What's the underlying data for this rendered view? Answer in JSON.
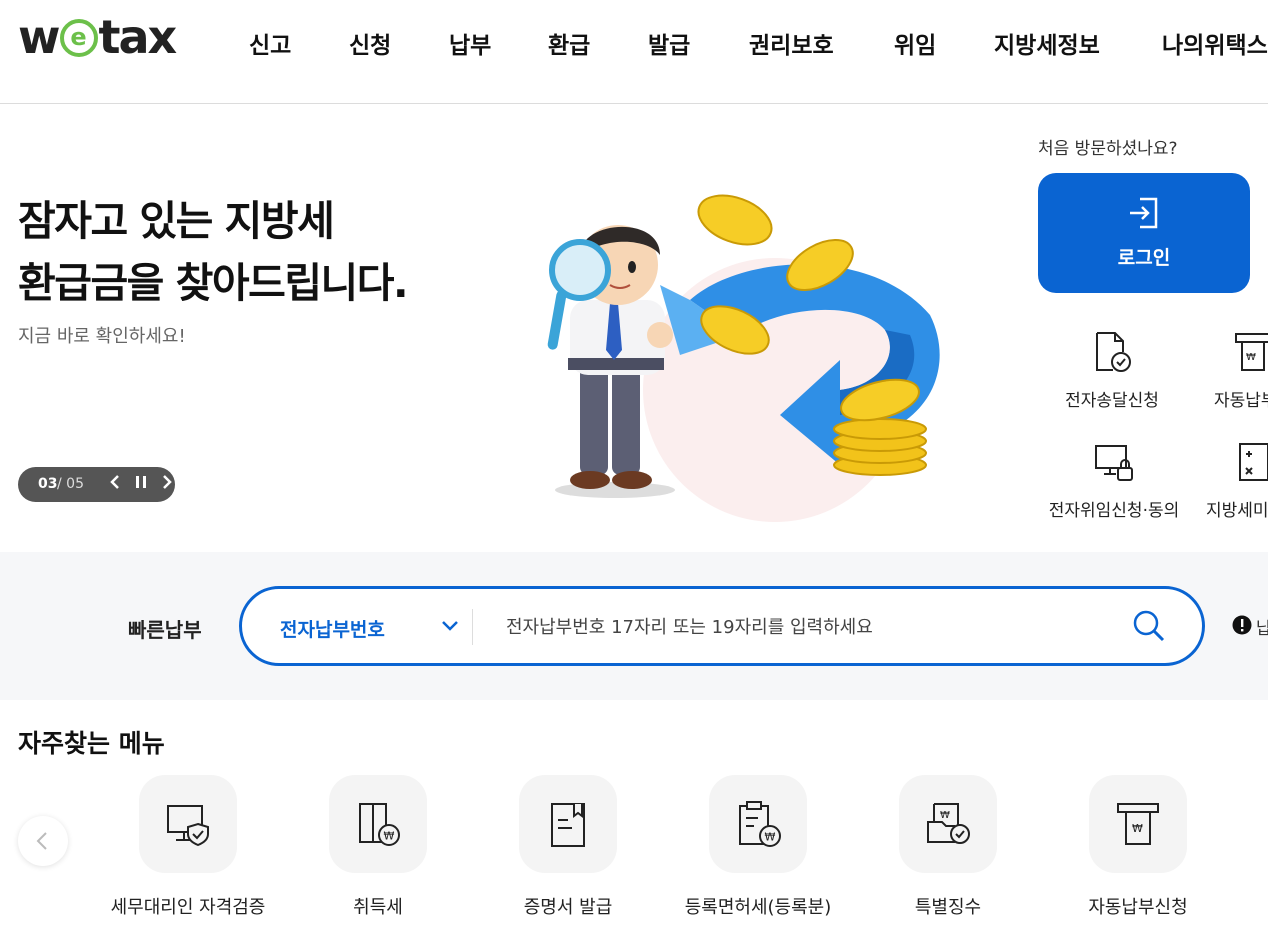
{
  "brand": {
    "logo_pre": "w",
    "logo_e": "e",
    "logo_post": "tax",
    "primary_color": "#0a64d2",
    "logo_accent": "#6cc04a"
  },
  "nav": [
    "신고",
    "신청",
    "납부",
    "환급",
    "발급",
    "권리보호",
    "위임",
    "지방세정보",
    "나의위택스"
  ],
  "hero": {
    "title_line1": "잠자고 있는 지방세",
    "title_line2": "환급금을 찾아드립니다.",
    "subtitle": "지금 바로 확인하세요!",
    "slide_current": "03",
    "slide_total": "/ 05",
    "illustration": "magnifier-man-coins-refund"
  },
  "sidebar": {
    "first_visit": "처음 방문하셨나요?",
    "login_label": "로그인",
    "quick_links": [
      {
        "label": "전자송달신청",
        "icon": "document-check-icon"
      },
      {
        "label": "자동납부",
        "icon": "auto-pay-icon"
      },
      {
        "label": "전자위임신청·동의",
        "icon": "monitor-lock-icon"
      },
      {
        "label": "지방세미",
        "icon": "calculator-icon"
      }
    ]
  },
  "fastpay": {
    "label": "빠른납부",
    "select_value": "전자납부번호",
    "placeholder": "전자납부번호 17자리 또는 19자리를 입력하세요",
    "info_text": "납"
  },
  "frequent": {
    "title": "자주찾는 메뉴",
    "items": [
      {
        "label": "세무대리인 자격검증",
        "icon": "monitor-shield-icon"
      },
      {
        "label": "취득세",
        "icon": "building-won-icon"
      },
      {
        "label": "증명서 발급",
        "icon": "certificate-icon"
      },
      {
        "label": "등록면허세(등록분)",
        "icon": "clipboard-won-icon"
      },
      {
        "label": "특별징수",
        "icon": "folder-check-icon"
      },
      {
        "label": "자동납부신청",
        "icon": "receipt-won-icon"
      }
    ]
  }
}
